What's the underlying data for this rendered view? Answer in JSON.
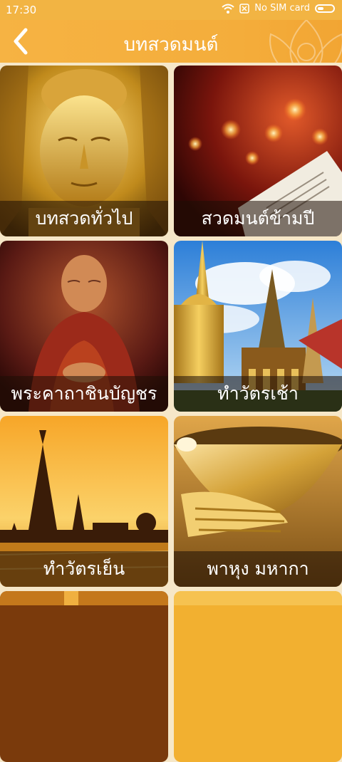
{
  "status_bar": {
    "time": "17:30",
    "sim_text": "No SIM card"
  },
  "header": {
    "title": "บทสวดมนต์"
  },
  "tiles": [
    {
      "label": "บทสวดทั่วไป"
    },
    {
      "label": "สวดมนต์ข้ามปี"
    },
    {
      "label": "พระคาถาชินบัญชร"
    },
    {
      "label": "ทำวัตรเช้า"
    },
    {
      "label": "ทำวัตรเย็น"
    },
    {
      "label": "พาหุง มหากา"
    },
    {
      "label": ""
    },
    {
      "label": ""
    }
  ],
  "colors": {
    "accent": "#f2b443",
    "page_bg": "#f6e7c8"
  }
}
